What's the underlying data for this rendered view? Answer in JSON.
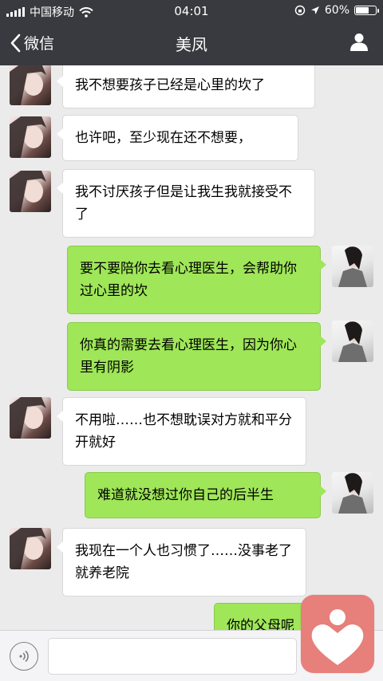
{
  "status": {
    "carrier": "中国移动",
    "time": "04:01",
    "battery": "60%"
  },
  "nav": {
    "back_label": "微信",
    "title": "美凤"
  },
  "messages": [
    {
      "from": "her",
      "text": "我不想要孩子已经是心里的坎了"
    },
    {
      "from": "her",
      "text": "也许吧，至少现在还不想要，"
    },
    {
      "from": "her",
      "text": "我不讨厌孩子但是让我生我就接受不了"
    },
    {
      "from": "me",
      "text": "要不要陪你去看心理医生，会帮助你过心里的坎"
    },
    {
      "from": "me",
      "text": "你真的需要去看心理医生，因为你心里有阴影"
    },
    {
      "from": "her",
      "text": "不用啦……也不想耽误对方就和平分开就好"
    },
    {
      "from": "me",
      "text": "难道就没想过你自己的后半生"
    },
    {
      "from": "her",
      "text": "我现在一个人也习惯了……没事老了就养老院"
    },
    {
      "from": "me",
      "text": "你的父母呢"
    }
  ],
  "colors": {
    "nav_bg": "#393a3f",
    "out_bubble": "#9fe658",
    "in_bubble": "#ffffff",
    "chat_bg": "#ebebeb",
    "heart_button": "#e77f7a"
  },
  "icons": {
    "back": "chevron-left-icon",
    "profile": "person-icon",
    "voice": "voice-icon",
    "floating": "heart-icon"
  }
}
